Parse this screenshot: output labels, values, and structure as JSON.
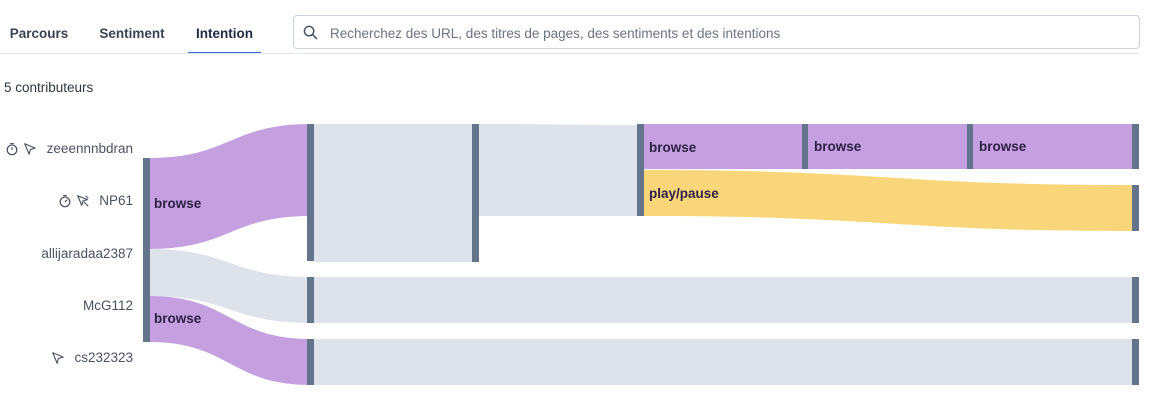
{
  "tabs": [
    {
      "label": "Parcours"
    },
    {
      "label": "Sentiment"
    },
    {
      "label": "Intention"
    }
  ],
  "active_tab": "Intention",
  "search": {
    "placeholder": "Recherchez des URL, des titres de pages, des sentiments et des intentions",
    "value": ""
  },
  "contributors_count": "5 contributeurs",
  "contributors": [
    {
      "name": "zeeennnbdran",
      "icons": [
        "stopwatch-icon",
        "cursor-arrow-icon"
      ]
    },
    {
      "name": "NP61",
      "icons": [
        "stopwatch-icon",
        "cursor-multi-icon"
      ]
    },
    {
      "name": "allijaradaa2387",
      "icons": []
    },
    {
      "name": "McG112",
      "icons": []
    },
    {
      "name": "cs232323",
      "icons": [
        "cursor-arrow-icon"
      ]
    }
  ],
  "flow_labels": {
    "start_browse_1": "browse",
    "start_browse_2": "browse",
    "step4_browse": "browse",
    "step4_play": "play/pause",
    "step5_browse": "browse",
    "step6_browse": "browse"
  },
  "colors": {
    "browse": "#c4a0e0",
    "play_pause": "#f9d67a",
    "neutral": "#dde2eb",
    "node_bar": "#64748b",
    "tab_underline": "#3b6fd8"
  }
}
